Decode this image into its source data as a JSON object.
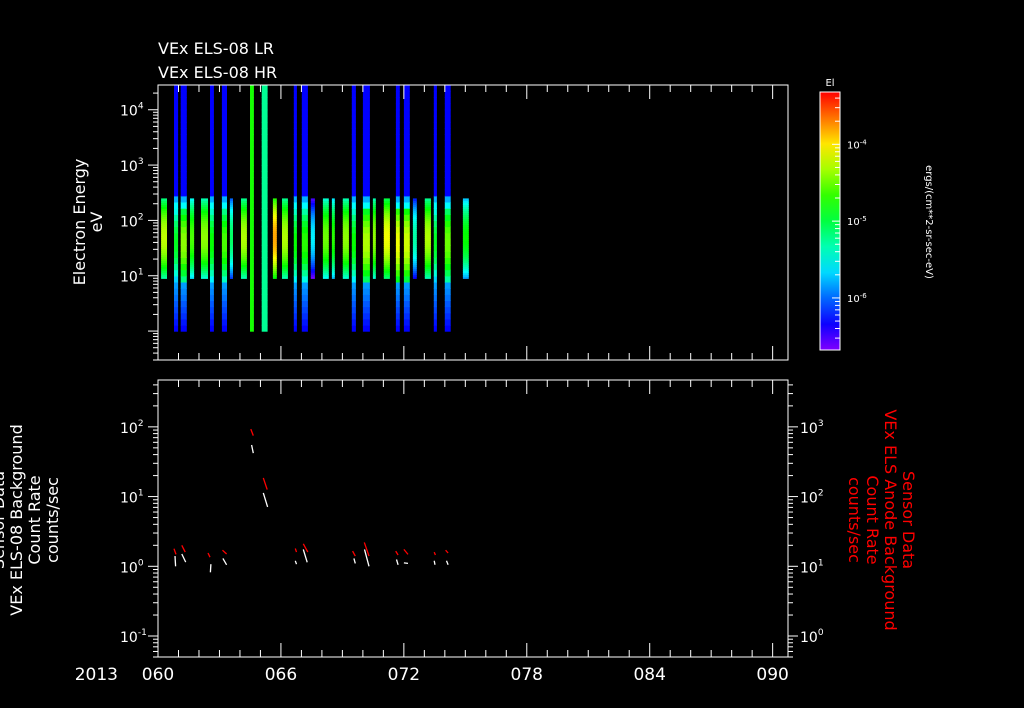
{
  "chart_data": [
    {
      "type": "heatmap",
      "titles": [
        "VEx ELS-08 LR",
        "VEx ELS-08 HR"
      ],
      "ylabel": [
        "Electron Energy",
        "eV"
      ],
      "yscale": "log",
      "ylim": [
        0.3,
        28000
      ],
      "ytick_exponents": [
        1,
        2,
        3,
        4
      ],
      "xlim": [
        60,
        90.75
      ],
      "colorbar": {
        "label": "El",
        "units": "ergs/(cm**2-sr-sec-eV)",
        "scale": "log",
        "range": [
          2.1e-07,
          0.00048
        ],
        "tick_exponents": [
          -4,
          -5,
          -6
        ]
      },
      "columns": [
        {
          "start": 60.15,
          "end": 60.44,
          "mode": "LR",
          "peak": -4.25
        },
        {
          "start": 60.78,
          "end": 60.98,
          "mode": "HR",
          "peak": -4.9
        },
        {
          "start": 61.11,
          "end": 61.41,
          "mode": "HR",
          "peak": -4.4
        },
        {
          "start": 61.56,
          "end": 61.76,
          "mode": "LR",
          "peak": -4.6
        },
        {
          "start": 62.1,
          "end": 62.44,
          "mode": "LR",
          "peak": -4.4
        },
        {
          "start": 62.54,
          "end": 62.73,
          "mode": "HR",
          "peak": -4.8
        },
        {
          "start": 63.12,
          "end": 63.37,
          "mode": "HR",
          "peak": -4.6
        },
        {
          "start": 63.51,
          "end": 63.66,
          "mode": "LR",
          "peak": -5.1
        },
        {
          "start": 64.05,
          "end": 64.34,
          "mode": "LR",
          "peak": -4.3
        },
        {
          "start": 64.49,
          "end": 64.68,
          "mode": "flat",
          "peak": -4.75
        },
        {
          "start": 65.06,
          "end": 65.35,
          "mode": "flat",
          "peak": -5.25
        },
        {
          "start": 65.61,
          "end": 65.8,
          "mode": "LR",
          "peak": -3.8
        },
        {
          "start": 66.05,
          "end": 66.34,
          "mode": "LR",
          "peak": -4.3
        },
        {
          "start": 66.63,
          "end": 66.78,
          "mode": "HR",
          "peak": -4.8
        },
        {
          "start": 67.02,
          "end": 67.32,
          "mode": "HR",
          "peak": -4.7
        },
        {
          "start": 67.46,
          "end": 67.66,
          "mode": "LR",
          "peak": -5.6
        },
        {
          "start": 68.05,
          "end": 68.34,
          "mode": "LR",
          "peak": -4.5
        },
        {
          "start": 68.49,
          "end": 68.63,
          "mode": "LR",
          "peak": -4.7
        },
        {
          "start": 69.02,
          "end": 69.32,
          "mode": "LR",
          "peak": -4.4
        },
        {
          "start": 69.46,
          "end": 69.66,
          "mode": "HR",
          "peak": -4.8
        },
        {
          "start": 70.0,
          "end": 70.34,
          "mode": "HR",
          "peak": -4.3
        },
        {
          "start": 70.49,
          "end": 70.63,
          "mode": "LR",
          "peak": -4.4
        },
        {
          "start": 71.02,
          "end": 71.32,
          "mode": "LR",
          "peak": -4.1
        },
        {
          "start": 71.61,
          "end": 71.8,
          "mode": "HR",
          "peak": -4.1
        },
        {
          "start": 72.0,
          "end": 72.29,
          "mode": "HR",
          "peak": -4.2
        },
        {
          "start": 72.44,
          "end": 72.63,
          "mode": "LR",
          "peak": -5.3
        },
        {
          "start": 73.02,
          "end": 73.32,
          "mode": "LR",
          "peak": -4.3
        },
        {
          "start": 73.46,
          "end": 73.61,
          "mode": "HR",
          "peak": -4.9
        },
        {
          "start": 74.0,
          "end": 74.29,
          "mode": "HR",
          "peak": -4.5
        },
        {
          "start": 74.88,
          "end": 75.17,
          "mode": "LR",
          "peak": -4.8
        }
      ]
    },
    {
      "type": "line",
      "ylabel_left": [
        "Sensor Data",
        "VEx ELS-08 Background",
        "Count Rate",
        "counts/sec"
      ],
      "ylabel_right": [
        "Sensor Data",
        "VEx ELS Anode Background",
        "Count Rate",
        "counts/sec"
      ],
      "yscale": "log",
      "ylim_left": [
        0.05,
        470
      ],
      "ylim_right": [
        0.5,
        4700
      ],
      "ytick_exponents_left": [
        -1,
        0,
        1,
        2
      ],
      "ytick_exponents_right": [
        0,
        1,
        2,
        3
      ],
      "xlim": [
        60,
        90.75
      ],
      "xlabel_year": "2013",
      "xtick_labels": [
        "060",
        "066",
        "072",
        "078",
        "084",
        "090"
      ],
      "xtick_values": [
        60,
        66,
        72,
        78,
        84,
        90
      ],
      "series": [
        {
          "name": "VEx ELS-08 Background",
          "axis": "left",
          "color": "#ffffff",
          "segments": [
            [
              [
                60.83,
                1.4
              ],
              [
                60.86,
                1.0
              ]
            ],
            [
              [
                61.16,
                1.5
              ],
              [
                61.35,
                1.15
              ]
            ],
            [
              [
                62.58,
                1.07
              ],
              [
                62.56,
                0.82
              ]
            ],
            [
              [
                63.17,
                1.3
              ],
              [
                63.35,
                1.05
              ]
            ],
            [
              [
                64.57,
                55
              ],
              [
                64.65,
                42
              ]
            ],
            [
              [
                65.14,
                11.3
              ],
              [
                65.35,
                7.1
              ]
            ],
            [
              [
                66.7,
                1.2
              ],
              [
                66.76,
                1.07
              ]
            ],
            [
              [
                67.09,
                1.75
              ],
              [
                67.28,
                1.14
              ]
            ],
            [
              [
                69.56,
                1.3
              ],
              [
                69.63,
                1.1
              ]
            ],
            [
              [
                70.08,
                1.75
              ],
              [
                70.3,
                1.0
              ]
            ],
            [
              [
                71.64,
                1.25
              ],
              [
                71.72,
                1.05
              ]
            ],
            [
              [
                72.0,
                1.12
              ],
              [
                72.2,
                1.1
              ]
            ],
            [
              [
                73.48,
                1.2
              ],
              [
                73.52,
                1.05
              ]
            ],
            [
              [
                74.08,
                1.2
              ],
              [
                74.16,
                1.05
              ]
            ]
          ]
        },
        {
          "name": "VEx ELS Anode Background",
          "axis": "right",
          "color": "#ff0000",
          "segments": [
            [
              [
                60.78,
                17.9
              ],
              [
                60.88,
                14.8
              ]
            ],
            [
              [
                61.16,
                20
              ],
              [
                61.33,
                16
              ]
            ],
            [
              [
                62.44,
                15.5
              ],
              [
                62.54,
                13.5
              ]
            ],
            [
              [
                63.15,
                17
              ],
              [
                63.35,
                15
              ]
            ],
            [
              [
                64.53,
                930
              ],
              [
                64.65,
                750
              ]
            ],
            [
              [
                65.14,
                185
              ],
              [
                65.33,
                126
              ]
            ],
            [
              [
                66.7,
                18
              ],
              [
                66.76,
                16
              ]
            ],
            [
              [
                67.09,
                21
              ],
              [
                67.31,
                16
              ]
            ],
            [
              [
                69.5,
                16.5
              ],
              [
                69.63,
                14
              ]
            ],
            [
              [
                70.07,
                22
              ],
              [
                70.3,
                14
              ]
            ],
            [
              [
                71.6,
                16.5
              ],
              [
                71.72,
                14.5
              ]
            ],
            [
              [
                72.0,
                17.5
              ],
              [
                72.2,
                14.8
              ]
            ],
            [
              [
                73.48,
                16
              ],
              [
                73.54,
                14.5
              ]
            ],
            [
              [
                74.04,
                17
              ],
              [
                74.16,
                15.5
              ]
            ]
          ]
        }
      ]
    }
  ]
}
